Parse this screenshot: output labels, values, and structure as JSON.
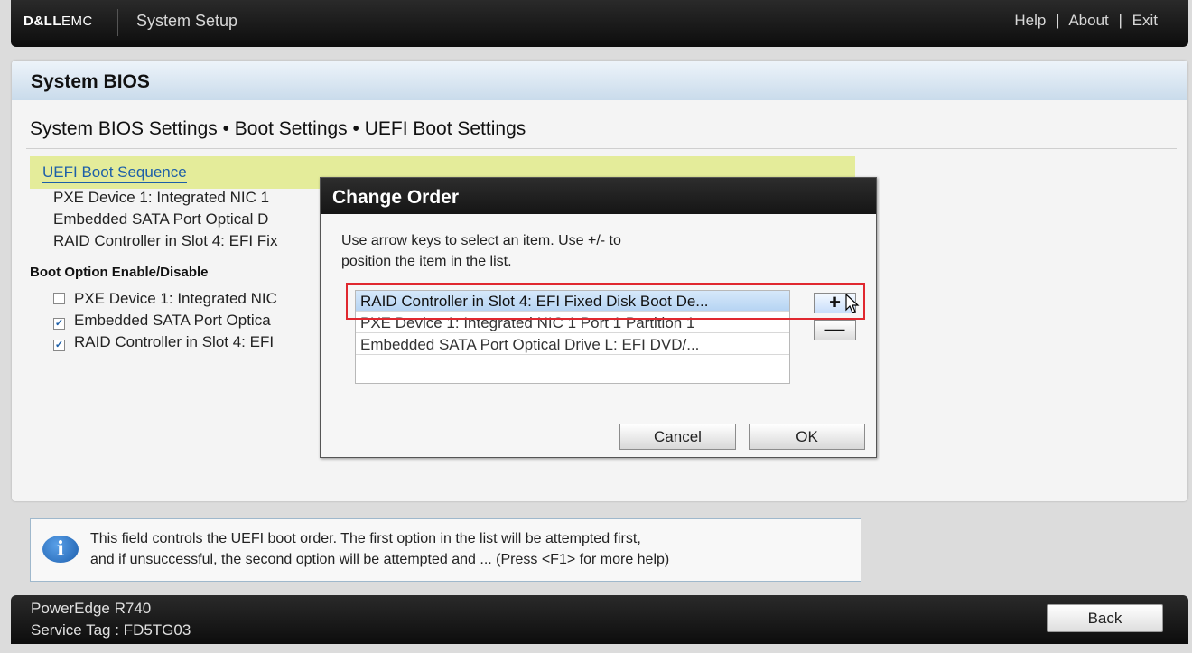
{
  "header": {
    "brand_dell": "D&LL",
    "brand_emc": "EMC",
    "app_title": "System Setup",
    "links": {
      "help": "Help",
      "about": "About",
      "exit": "Exit",
      "separator": "|"
    }
  },
  "panel": {
    "title": "System BIOS",
    "breadcrumb": "System BIOS Settings • Boot Settings • UEFI Boot Settings"
  },
  "boot_sequence": {
    "label": "UEFI Boot Sequence",
    "items": [
      "PXE Device 1: Integrated NIC 1",
      "Embedded SATA Port Optical D",
      "RAID Controller in Slot 4: EFI Fix"
    ]
  },
  "boot_options": {
    "title": "Boot Option Enable/Disable",
    "items": [
      {
        "label": "PXE Device 1: Integrated NIC",
        "checked": false
      },
      {
        "label": "Embedded SATA Port Optica",
        "checked": true
      },
      {
        "label": "RAID Controller in Slot 4: EFI",
        "checked": true
      }
    ]
  },
  "dialog": {
    "title": "Change Order",
    "message_line1": "Use arrow keys to select an item. Use +/- to",
    "message_line2": "position the item in the list.",
    "list": [
      {
        "label": "RAID Controller in Slot 4: EFI Fixed Disk Boot De...",
        "selected": true
      },
      {
        "label": "PXE Device 1: Integrated NIC 1 Port 1 Partition 1",
        "selected": false
      },
      {
        "label": "Embedded SATA Port Optical Drive L: EFI DVD/...",
        "selected": false
      }
    ],
    "plus_label": "+",
    "minus_label": "—",
    "cancel_label": "Cancel",
    "ok_label": "OK"
  },
  "info": {
    "icon": "info-icon",
    "icon_glyph": "i",
    "line1": "This field controls the UEFI boot order. The first option in the list will be attempted first,",
    "line2": "and if unsuccessful, the second option will be attempted and ... (Press <F1> for more help)"
  },
  "footer": {
    "model": "PowerEdge R740",
    "service_tag": "Service Tag : FD5TG03",
    "back_label": "Back"
  },
  "colors": {
    "highlight": "#e4ec9a",
    "link": "#1d5fa8",
    "annotation_box": "#e0282f",
    "selected_row": "#c6ddf6"
  }
}
